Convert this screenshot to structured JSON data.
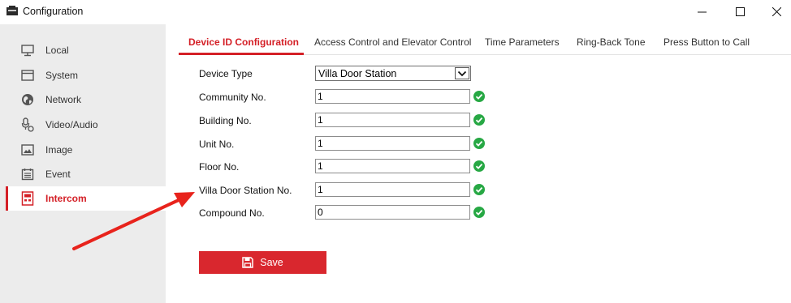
{
  "window": {
    "title": "Configuration"
  },
  "sidebar": {
    "items": [
      {
        "label": "Local",
        "icon": "monitor-icon"
      },
      {
        "label": "System",
        "icon": "window-icon"
      },
      {
        "label": "Network",
        "icon": "globe-icon"
      },
      {
        "label": "Video/Audio",
        "icon": "camera-mic-icon"
      },
      {
        "label": "Image",
        "icon": "image-icon"
      },
      {
        "label": "Event",
        "icon": "calendar-icon"
      },
      {
        "label": "Intercom",
        "icon": "intercom-icon",
        "active": true
      }
    ]
  },
  "tabs": [
    {
      "label": "Device ID Configuration",
      "active": true
    },
    {
      "label": "Access Control and Elevator Control"
    },
    {
      "label": "Time Parameters"
    },
    {
      "label": "Ring-Back Tone"
    },
    {
      "label": "Press Button to Call"
    }
  ],
  "form": {
    "device_type": {
      "label": "Device Type",
      "value": "Villa Door Station"
    },
    "community_no": {
      "label": "Community No.",
      "value": "1"
    },
    "building_no": {
      "label": "Building No.",
      "value": "1"
    },
    "unit_no": {
      "label": "Unit No.",
      "value": "1"
    },
    "floor_no": {
      "label": "Floor No.",
      "value": "1"
    },
    "villa_door_station_no": {
      "label": "Villa Door Station No.",
      "value": "1"
    },
    "compound_no": {
      "label": "Compound No.",
      "value": "0"
    }
  },
  "save_button": {
    "label": "Save"
  },
  "colors": {
    "accent": "#d42027",
    "valid": "#27a844",
    "sidebar_bg": "#ececec",
    "annotation_arrow": "#e8231c"
  }
}
